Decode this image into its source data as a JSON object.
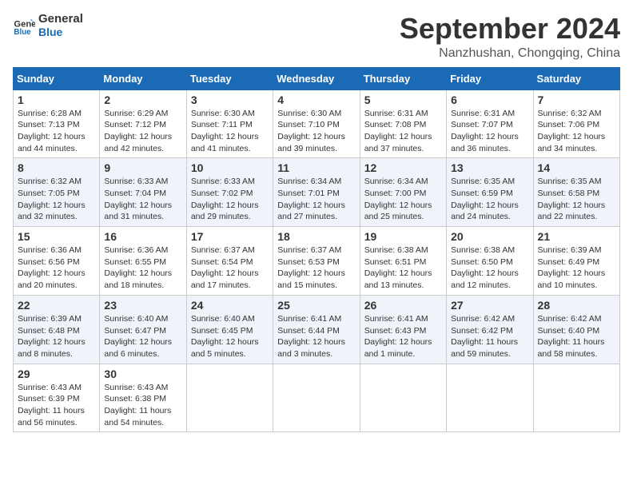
{
  "header": {
    "logo_line1": "General",
    "logo_line2": "Blue",
    "month": "September 2024",
    "location": "Nanzhushan, Chongqing, China"
  },
  "weekdays": [
    "Sunday",
    "Monday",
    "Tuesday",
    "Wednesday",
    "Thursday",
    "Friday",
    "Saturday"
  ],
  "weeks": [
    [
      {
        "day": "1",
        "sunrise": "6:28 AM",
        "sunset": "7:13 PM",
        "daylight": "12 hours and 44 minutes."
      },
      {
        "day": "2",
        "sunrise": "6:29 AM",
        "sunset": "7:12 PM",
        "daylight": "12 hours and 42 minutes."
      },
      {
        "day": "3",
        "sunrise": "6:30 AM",
        "sunset": "7:11 PM",
        "daylight": "12 hours and 41 minutes."
      },
      {
        "day": "4",
        "sunrise": "6:30 AM",
        "sunset": "7:10 PM",
        "daylight": "12 hours and 39 minutes."
      },
      {
        "day": "5",
        "sunrise": "6:31 AM",
        "sunset": "7:08 PM",
        "daylight": "12 hours and 37 minutes."
      },
      {
        "day": "6",
        "sunrise": "6:31 AM",
        "sunset": "7:07 PM",
        "daylight": "12 hours and 36 minutes."
      },
      {
        "day": "7",
        "sunrise": "6:32 AM",
        "sunset": "7:06 PM",
        "daylight": "12 hours and 34 minutes."
      }
    ],
    [
      {
        "day": "8",
        "sunrise": "6:32 AM",
        "sunset": "7:05 PM",
        "daylight": "12 hours and 32 minutes."
      },
      {
        "day": "9",
        "sunrise": "6:33 AM",
        "sunset": "7:04 PM",
        "daylight": "12 hours and 31 minutes."
      },
      {
        "day": "10",
        "sunrise": "6:33 AM",
        "sunset": "7:02 PM",
        "daylight": "12 hours and 29 minutes."
      },
      {
        "day": "11",
        "sunrise": "6:34 AM",
        "sunset": "7:01 PM",
        "daylight": "12 hours and 27 minutes."
      },
      {
        "day": "12",
        "sunrise": "6:34 AM",
        "sunset": "7:00 PM",
        "daylight": "12 hours and 25 minutes."
      },
      {
        "day": "13",
        "sunrise": "6:35 AM",
        "sunset": "6:59 PM",
        "daylight": "12 hours and 24 minutes."
      },
      {
        "day": "14",
        "sunrise": "6:35 AM",
        "sunset": "6:58 PM",
        "daylight": "12 hours and 22 minutes."
      }
    ],
    [
      {
        "day": "15",
        "sunrise": "6:36 AM",
        "sunset": "6:56 PM",
        "daylight": "12 hours and 20 minutes."
      },
      {
        "day": "16",
        "sunrise": "6:36 AM",
        "sunset": "6:55 PM",
        "daylight": "12 hours and 18 minutes."
      },
      {
        "day": "17",
        "sunrise": "6:37 AM",
        "sunset": "6:54 PM",
        "daylight": "12 hours and 17 minutes."
      },
      {
        "day": "18",
        "sunrise": "6:37 AM",
        "sunset": "6:53 PM",
        "daylight": "12 hours and 15 minutes."
      },
      {
        "day": "19",
        "sunrise": "6:38 AM",
        "sunset": "6:51 PM",
        "daylight": "12 hours and 13 minutes."
      },
      {
        "day": "20",
        "sunrise": "6:38 AM",
        "sunset": "6:50 PM",
        "daylight": "12 hours and 12 minutes."
      },
      {
        "day": "21",
        "sunrise": "6:39 AM",
        "sunset": "6:49 PM",
        "daylight": "12 hours and 10 minutes."
      }
    ],
    [
      {
        "day": "22",
        "sunrise": "6:39 AM",
        "sunset": "6:48 PM",
        "daylight": "12 hours and 8 minutes."
      },
      {
        "day": "23",
        "sunrise": "6:40 AM",
        "sunset": "6:47 PM",
        "daylight": "12 hours and 6 minutes."
      },
      {
        "day": "24",
        "sunrise": "6:40 AM",
        "sunset": "6:45 PM",
        "daylight": "12 hours and 5 minutes."
      },
      {
        "day": "25",
        "sunrise": "6:41 AM",
        "sunset": "6:44 PM",
        "daylight": "12 hours and 3 minutes."
      },
      {
        "day": "26",
        "sunrise": "6:41 AM",
        "sunset": "6:43 PM",
        "daylight": "12 hours and 1 minute."
      },
      {
        "day": "27",
        "sunrise": "6:42 AM",
        "sunset": "6:42 PM",
        "daylight": "11 hours and 59 minutes."
      },
      {
        "day": "28",
        "sunrise": "6:42 AM",
        "sunset": "6:40 PM",
        "daylight": "11 hours and 58 minutes."
      }
    ],
    [
      {
        "day": "29",
        "sunrise": "6:43 AM",
        "sunset": "6:39 PM",
        "daylight": "11 hours and 56 minutes."
      },
      {
        "day": "30",
        "sunrise": "6:43 AM",
        "sunset": "6:38 PM",
        "daylight": "11 hours and 54 minutes."
      },
      null,
      null,
      null,
      null,
      null
    ]
  ]
}
